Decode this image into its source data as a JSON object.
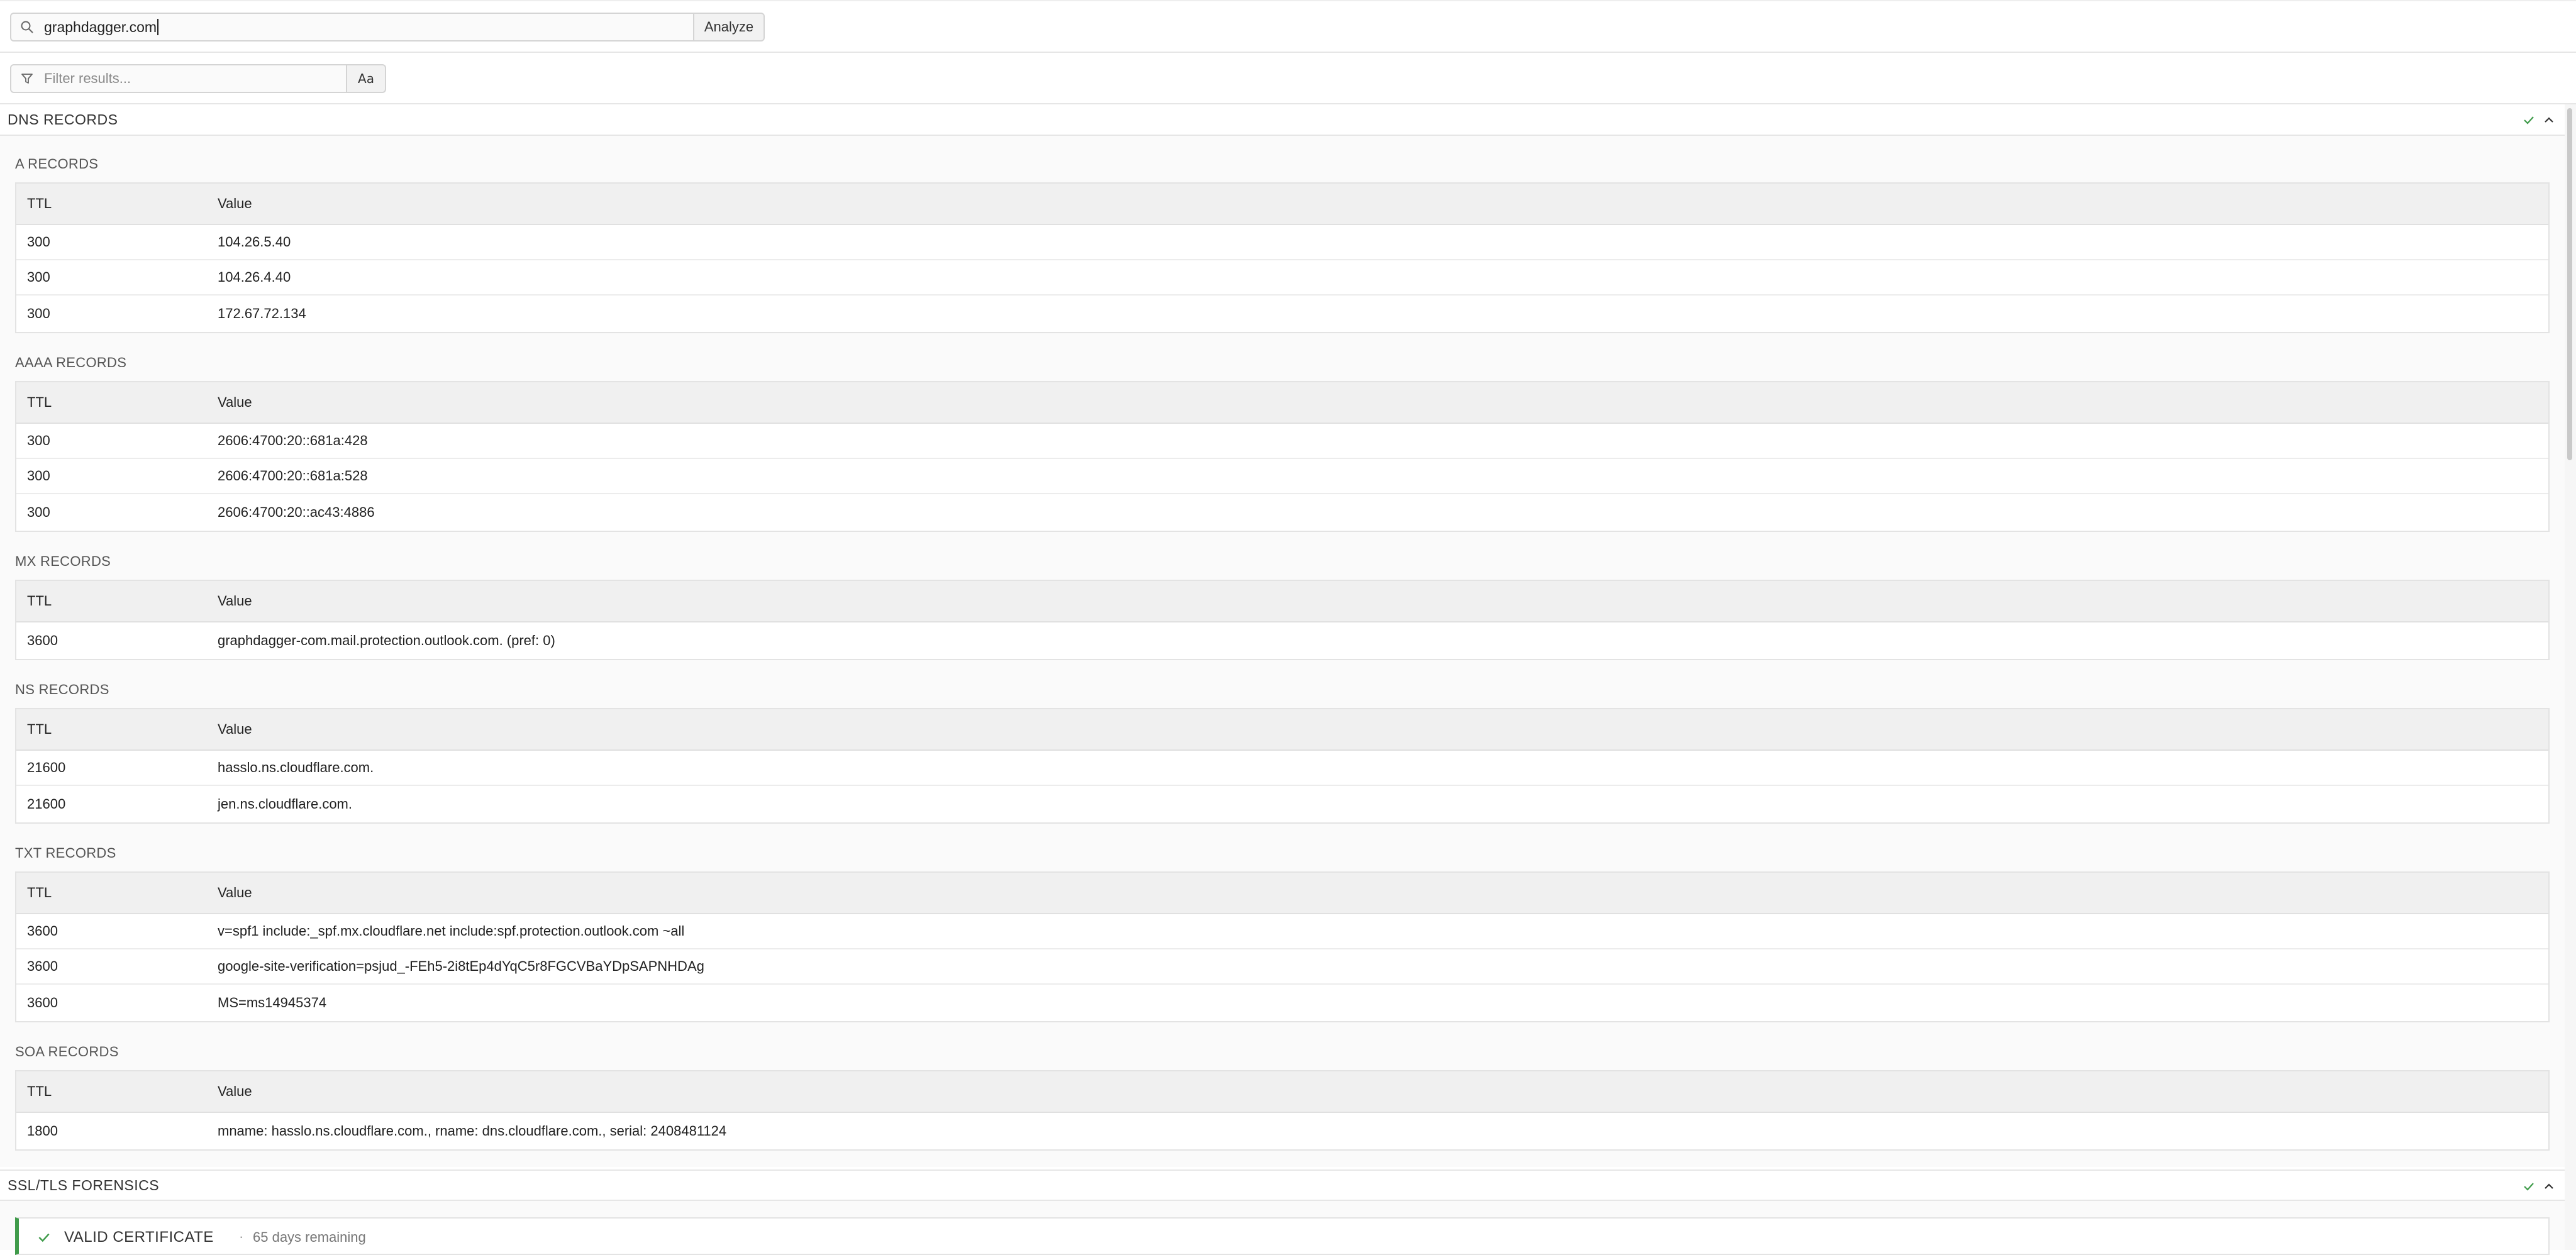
{
  "search": {
    "value": "graphdagger.com",
    "analyze_label": "Analyze"
  },
  "filter": {
    "placeholder": "Filter results...",
    "case_toggle": "Aa"
  },
  "dns_section": {
    "title": "DNS RECORDS",
    "groups": [
      {
        "title": "A RECORDS",
        "headers": [
          "TTL",
          "Value"
        ],
        "rows": [
          [
            "300",
            "104.26.5.40"
          ],
          [
            "300",
            "104.26.4.40"
          ],
          [
            "300",
            "172.67.72.134"
          ]
        ]
      },
      {
        "title": "AAAA RECORDS",
        "headers": [
          "TTL",
          "Value"
        ],
        "rows": [
          [
            "300",
            "2606:4700:20::681a:428"
          ],
          [
            "300",
            "2606:4700:20::681a:528"
          ],
          [
            "300",
            "2606:4700:20::ac43:4886"
          ]
        ]
      },
      {
        "title": "MX RECORDS",
        "headers": [
          "TTL",
          "Value"
        ],
        "rows": [
          [
            "3600",
            "graphdagger-com.mail.protection.outlook.com. (pref: 0)"
          ]
        ]
      },
      {
        "title": "NS RECORDS",
        "headers": [
          "TTL",
          "Value"
        ],
        "rows": [
          [
            "21600",
            "hasslo.ns.cloudflare.com."
          ],
          [
            "21600",
            "jen.ns.cloudflare.com."
          ]
        ]
      },
      {
        "title": "TXT RECORDS",
        "headers": [
          "TTL",
          "Value"
        ],
        "rows": [
          [
            "3600",
            "v=spf1 include:_spf.mx.cloudflare.net include:spf.protection.outlook.com ~all"
          ],
          [
            "3600",
            "google-site-verification=psjud_-FEh5-2i8tEp4dYqC5r8FGCVBaYDpSAPNHDAg"
          ],
          [
            "3600",
            "MS=ms14945374"
          ]
        ]
      },
      {
        "title": "SOA RECORDS",
        "headers": [
          "TTL",
          "Value"
        ],
        "rows": [
          [
            "1800",
            "mname: hasslo.ns.cloudflare.com., rname: dns.cloudflare.com., serial: 2408481124"
          ]
        ]
      }
    ]
  },
  "ssl_section": {
    "title": "SSL/TLS FORENSICS",
    "status": "VALID CERTIFICATE",
    "separator": "·",
    "days_remaining": "65 days remaining"
  },
  "colors": {
    "accent_green": "#3f9b4a"
  }
}
